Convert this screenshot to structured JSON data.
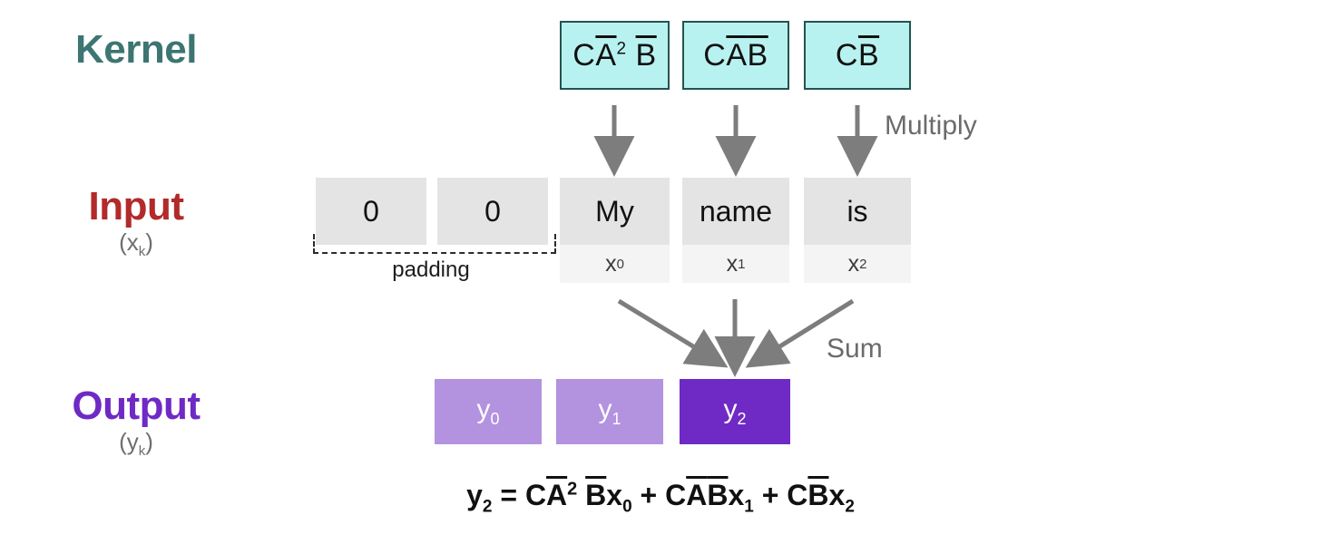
{
  "rows": {
    "kernel": {
      "label": "Kernel",
      "color": "#3c7572"
    },
    "input": {
      "label": "Input",
      "sub_open": "(x",
      "sub_k": "k",
      "sub_close": ")",
      "color": "#b22a2a"
    },
    "output": {
      "label": "Output",
      "sub_open": "(y",
      "sub_k": "k",
      "sub_close": ")",
      "color": "#6f29c4"
    }
  },
  "kernel": {
    "boxes": [
      {
        "id": "k0",
        "text": "CĀ²B̄",
        "c": "C",
        "a": "A",
        "sup": "2",
        "b": "B",
        "has_sup": true,
        "a_bar": true,
        "b_bar": true
      },
      {
        "id": "k1",
        "text": "CĀB̄",
        "c": "C",
        "a": "A",
        "sup": "",
        "b": "B",
        "has_sup": false,
        "a_bar": true,
        "b_bar": true
      },
      {
        "id": "k2",
        "text": "CB̄",
        "c": "C",
        "a": "",
        "sup": "",
        "b": "B",
        "has_sup": false,
        "a_bar": false,
        "b_bar": true
      }
    ],
    "fill": "#b8f2f0",
    "border": "#24534f"
  },
  "input": {
    "padding_cells": [
      {
        "value": "0"
      },
      {
        "value": "0"
      }
    ],
    "padding_label": "padding",
    "tokens": [
      {
        "word": "My",
        "var": "x",
        "index": "0"
      },
      {
        "word": "name",
        "var": "x",
        "index": "1"
      },
      {
        "word": "is",
        "var": "x",
        "index": "2"
      }
    ],
    "fill_top": "#e4e4e4",
    "fill_bottom": "#f4f4f4"
  },
  "output": {
    "boxes": [
      {
        "var": "y",
        "index": "0",
        "highlight": false
      },
      {
        "var": "y",
        "index": "1",
        "highlight": false
      },
      {
        "var": "y",
        "index": "2",
        "highlight": true
      }
    ],
    "fill_light": "#b392e0",
    "fill_dark": "#6f29c4"
  },
  "annotations": {
    "multiply": "Multiply",
    "sum": "Sum",
    "arrow_color": "#7d7d7d"
  },
  "equation": {
    "lhs_var": "y",
    "lhs_index": "2",
    "eq": "=",
    "term1": {
      "c": "C",
      "a": "A",
      "sup": "2",
      "b": "B",
      "x": "x",
      "idx": "0"
    },
    "plus1": "+",
    "term2": {
      "c": "C",
      "a": "A",
      "sup": "",
      "b": "B",
      "x": "x",
      "idx": "1"
    },
    "plus2": "+",
    "term3": {
      "c": "C",
      "a": "",
      "sup": "",
      "b": "B",
      "x": "x",
      "idx": "2"
    },
    "plain": "y₂ = CĀ²B̄x₀ + CĀB̄x₁ + CB̄x₂"
  }
}
